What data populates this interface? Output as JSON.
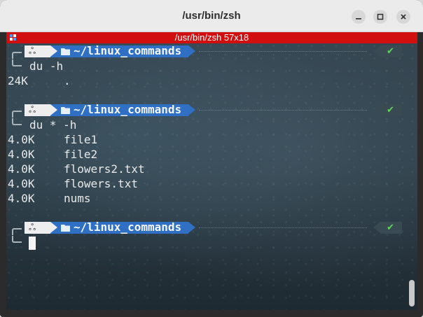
{
  "window": {
    "title": "/usr/bin/zsh",
    "status_text": "/usr/bin/zsh 57x18"
  },
  "prompt": {
    "os_icon": "linux-penguin-icon",
    "os_glyph": "ஃ",
    "path": "~/linux_commands",
    "status_glyph": "✔"
  },
  "terminal": {
    "blocks": [
      {
        "command": "du -h",
        "output": [
          {
            "size": "24K",
            "name": "."
          }
        ]
      },
      {
        "command": "du * -h",
        "output": [
          {
            "size": "4.0K",
            "name": "file1"
          },
          {
            "size": "4.0K",
            "name": "file2"
          },
          {
            "size": "4.0K",
            "name": "flowers2.txt"
          },
          {
            "size": "4.0K",
            "name": "flowers.txt"
          },
          {
            "size": "4.0K",
            "name": "nums"
          }
        ]
      }
    ]
  },
  "colors": {
    "status_strip": "#d20f0f",
    "path_segment": "#2f70c4",
    "os_segment": "#eeeeee",
    "ok_check": "#5fd75f"
  }
}
